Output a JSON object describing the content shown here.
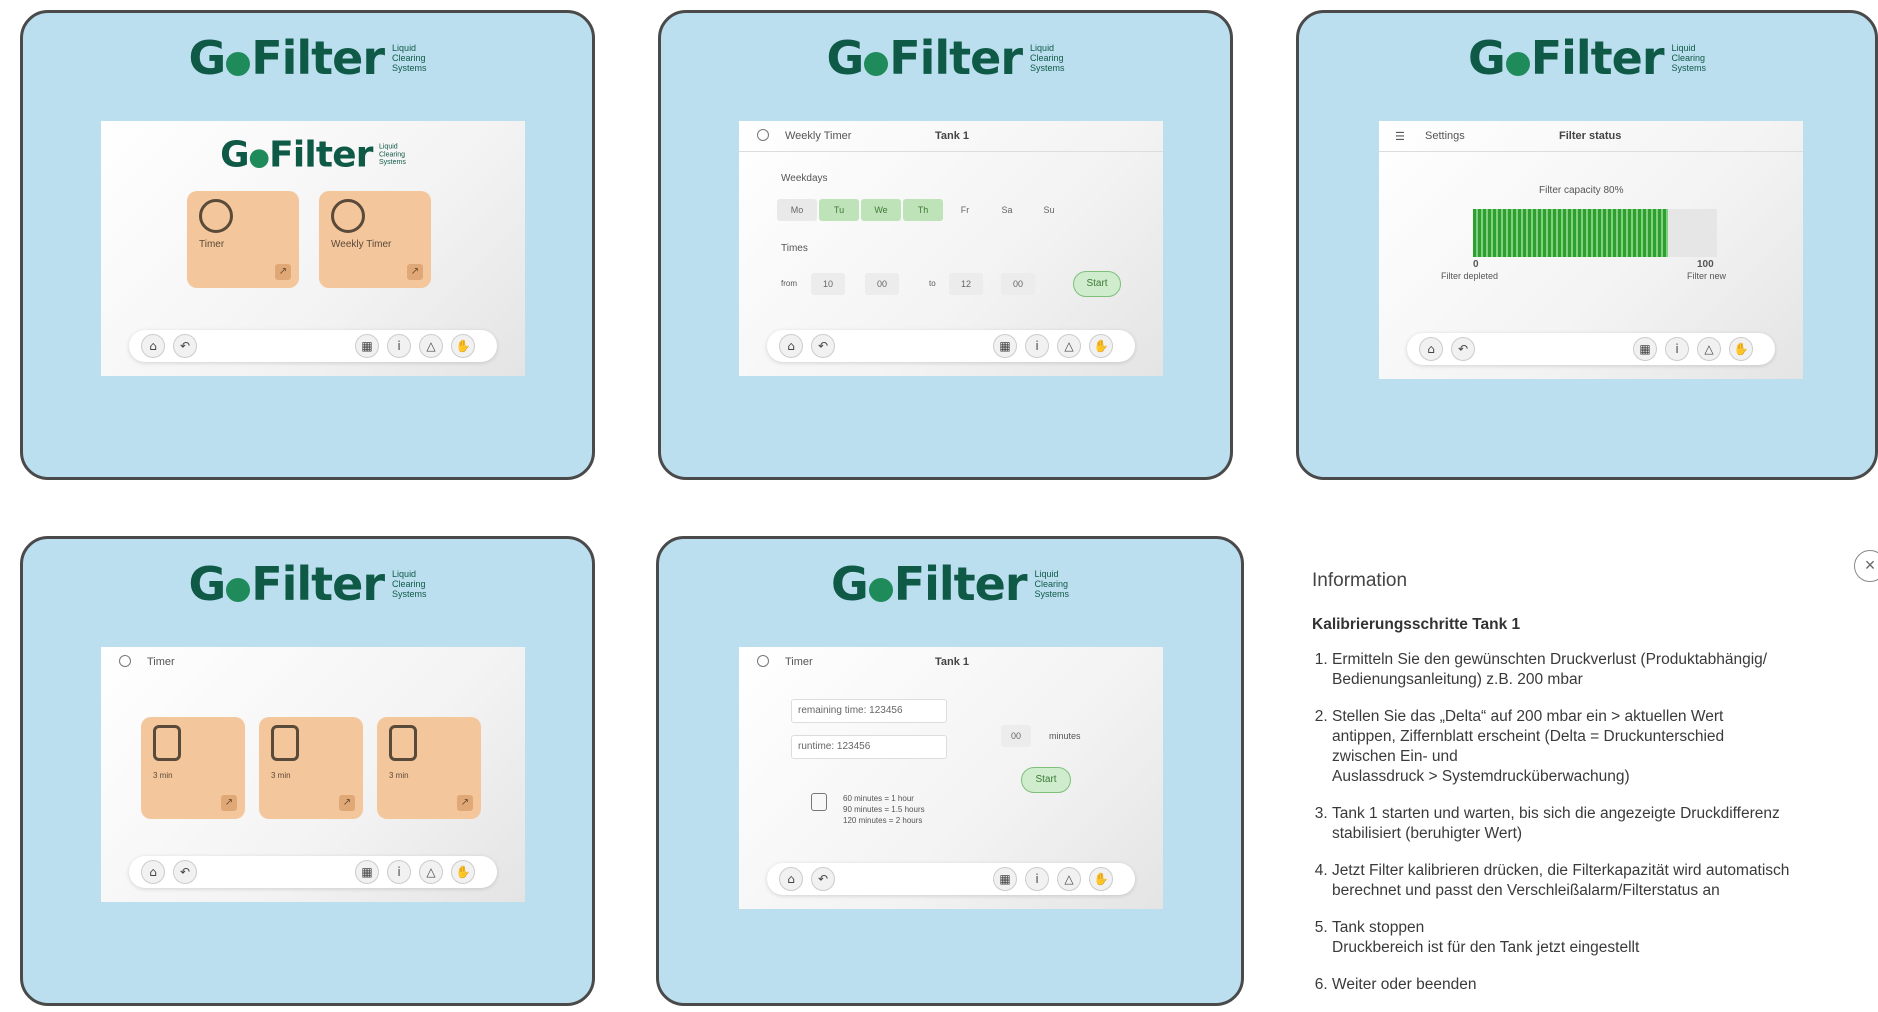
{
  "brand": {
    "logo_prefix": "G",
    "logo_suffix": "Filter",
    "tagline": [
      "Liquid",
      "Clearing",
      "Systems"
    ]
  },
  "nav_icons": [
    "home-icon",
    "back-icon",
    "calendar-icon",
    "info-icon",
    "warning-icon",
    "hand-icon"
  ],
  "nav_glyphs": {
    "home": "⌂",
    "back": "↶",
    "calendar": "▦",
    "info": "i",
    "warning": "△",
    "hand": "✋"
  },
  "panel1": {
    "tiles": [
      {
        "label": "Timer",
        "icon": "gauge-icon"
      },
      {
        "label": "Weekly Timer",
        "icon": "stopwatch-icon"
      }
    ]
  },
  "panel2": {
    "title": "Weekly Timer",
    "tank": "Tank 1",
    "weekdays_label": "Weekdays",
    "weekdays": [
      {
        "label": "Mo",
        "active": false
      },
      {
        "label": "Tu",
        "active": true
      },
      {
        "label": "We",
        "active": true
      },
      {
        "label": "Th",
        "active": true
      },
      {
        "label": "Fr",
        "active": false
      },
      {
        "label": "Sa",
        "active": false
      },
      {
        "label": "Su",
        "active": false
      }
    ],
    "times_label": "Times",
    "from_label": "from",
    "from_h": "10",
    "from_m": "00",
    "to_label": "to",
    "to_h": "12",
    "to_m": "00",
    "start": "Start"
  },
  "panel3": {
    "title": "Settings",
    "subtitle": "Filter status",
    "capacity_label": "Filter capacity 80%",
    "capacity": 0.8,
    "min_value": "0",
    "min_label": "Filter depleted",
    "max_value": "100",
    "max_label": "Filter new"
  },
  "panel4": {
    "title": "Timer",
    "tiles": [
      {
        "label": "3 min"
      },
      {
        "label": "3 min"
      },
      {
        "label": "3 min"
      }
    ]
  },
  "panel5": {
    "title": "Timer",
    "tank": "Tank 1",
    "remaining": "remaining time: 123456",
    "runtime": "runtime: 123456",
    "minutes_value": "00",
    "minutes_label": "minutes",
    "start": "Start",
    "hints": [
      "60 minutes = 1 hour",
      "90 minutes = 1.5 hours",
      "120 minutes = 2 hours"
    ]
  },
  "info": {
    "heading": "Information",
    "subheading": "Kalibrierungsschritte Tank 1",
    "close": "×",
    "steps": [
      [
        "Ermitteln Sie den gewünschten Druckverlust (Produktabhängig/",
        "Bedienungsanleitung) z.B. 200 mbar"
      ],
      [
        "Stellen Sie das „Delta“ auf 200 mbar ein > aktuellen Wert",
        "antippen, Ziffernblatt erscheint (Delta = Druckunterschied",
        "zwischen Ein- und",
        "Auslassdruck > Systemdrucküberwachung)"
      ],
      [
        "Tank 1 starten und warten, bis sich die angezeigte Druckdifferenz",
        "stabilisiert (beruhigter Wert)"
      ],
      [
        "Jetzt Filter kalibrieren drücken, die Filterkapazität wird automatisch",
        "berechnet und passt den Verschleißalarm/Filterstatus an"
      ],
      [
        "Tank stoppen",
        "Druckbereich ist für den Tank jetzt eingestellt"
      ],
      [
        "Weiter oder beenden"
      ]
    ]
  }
}
